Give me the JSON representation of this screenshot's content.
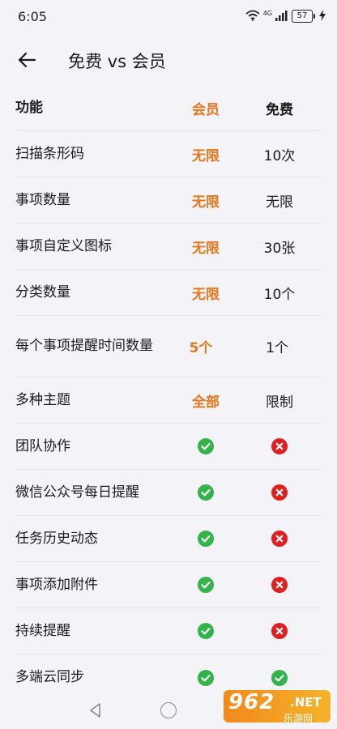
{
  "status_bar": {
    "time": "6:05",
    "network": "4G",
    "battery": "57"
  },
  "header": {
    "title": "免费 vs 会员"
  },
  "table": {
    "columns": {
      "feature": "功能",
      "vip": "会员",
      "free": "免费"
    },
    "rows": [
      {
        "feature": "扫描条形码",
        "vip": "无限",
        "free": "10次"
      },
      {
        "feature": "事项数量",
        "vip": "无限",
        "free": "无限"
      },
      {
        "feature": "事项自定义图标",
        "vip": "无限",
        "free": "30张"
      },
      {
        "feature": "分类数量",
        "vip": "无限",
        "free": "10个"
      },
      {
        "feature": "每个事项提醒时间数量",
        "vip": "5个",
        "free": "1个"
      },
      {
        "feature": "多种主题",
        "vip": "全部",
        "free": "限制"
      },
      {
        "feature": "团队协作",
        "vip": "check",
        "free": "cross"
      },
      {
        "feature": "微信公众号每日提醒",
        "vip": "check",
        "free": "cross"
      },
      {
        "feature": "任务历史动态",
        "vip": "check",
        "free": "cross"
      },
      {
        "feature": "事项添加附件",
        "vip": "check",
        "free": "cross"
      },
      {
        "feature": "持续提醒",
        "vip": "check",
        "free": "cross"
      },
      {
        "feature": "多端云同步",
        "vip": "check",
        "free": "check"
      }
    ]
  },
  "colors": {
    "accent": "#e8771c",
    "check": "#34b34a",
    "cross": "#e0201f",
    "background": "#f3f3f8"
  },
  "watermark": {
    "main": "962",
    "net": ".NET",
    "sub": "乐游网"
  }
}
